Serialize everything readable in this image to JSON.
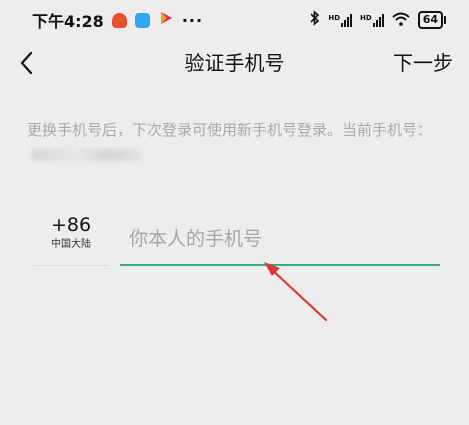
{
  "status_bar": {
    "time": "下午4:28",
    "signal1_label": "HD",
    "signal2_label": "HD",
    "battery": "64",
    "overflow": "···"
  },
  "nav": {
    "title": "验证手机号",
    "next_label": "下一步",
    "back_icon": "chevron-left-icon"
  },
  "hint": {
    "text": "更换手机号后，下次登录可使用新手机号登录。当前手机号："
  },
  "phone": {
    "country_code": "+86",
    "region": "中国大陆",
    "placeholder": "你本人的手机号"
  },
  "colors": {
    "accent": "#30b080",
    "annotation_arrow": "#d93a30",
    "background": "#ededed",
    "hint_text": "#a9a9a9"
  }
}
